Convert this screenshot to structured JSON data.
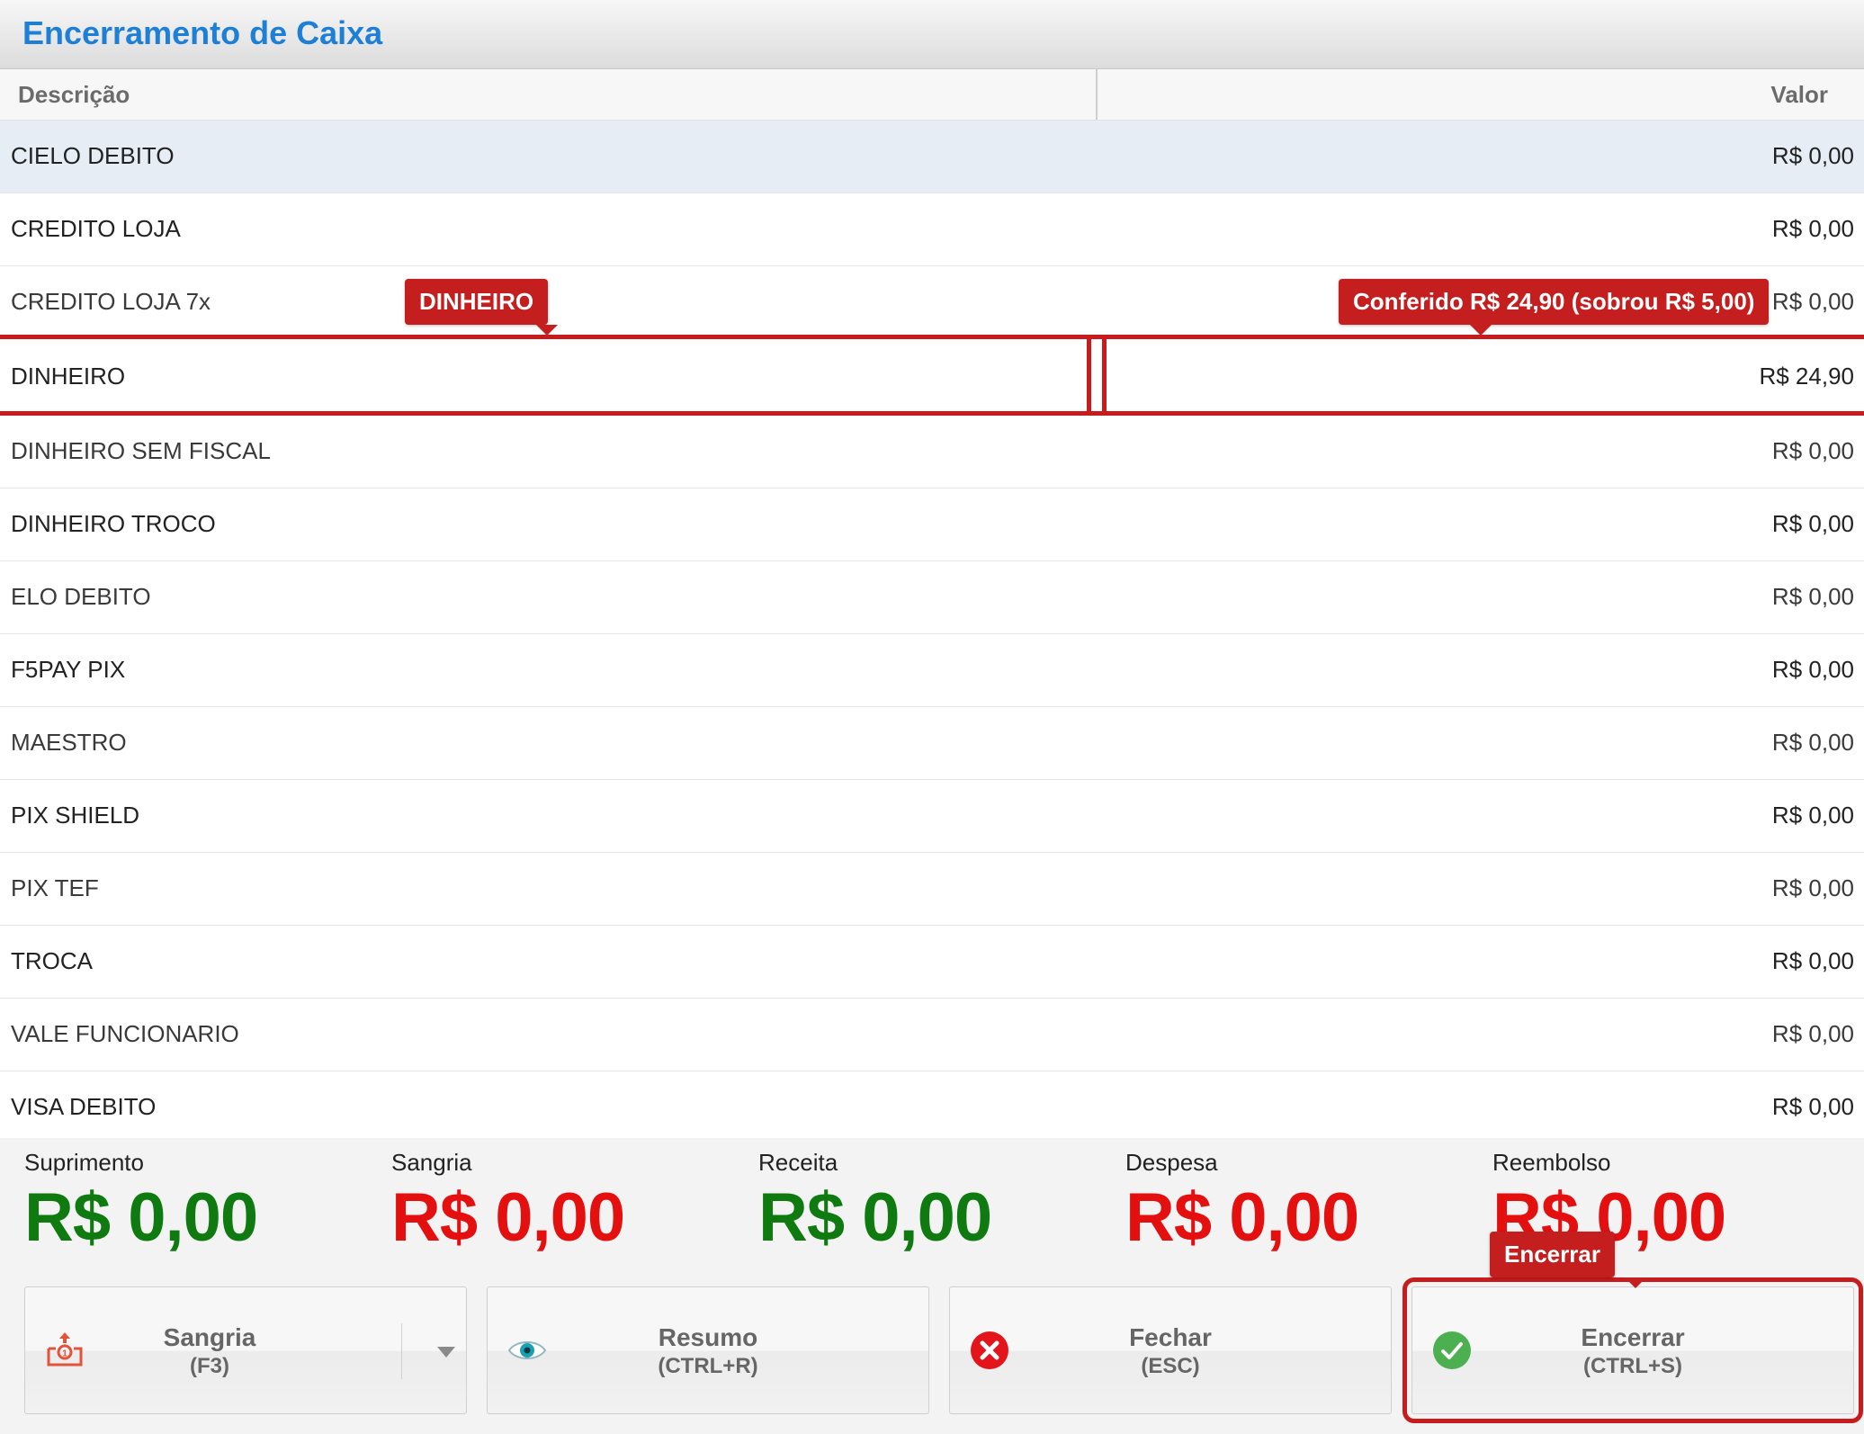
{
  "window": {
    "title": "Encerramento de Caixa"
  },
  "table": {
    "headers": {
      "description": "Descrição",
      "value": "Valor"
    },
    "rows": [
      {
        "label": "CIELO DEBITO",
        "value": "R$ 0,00"
      },
      {
        "label": "CREDITO LOJA",
        "value": "R$ 0,00"
      },
      {
        "label": "CREDITO LOJA 7x",
        "value": "R$ 0,00"
      },
      {
        "label": "DINHEIRO",
        "value": "R$ 24,90"
      },
      {
        "label": "DINHEIRO SEM FISCAL",
        "value": "R$ 0,00"
      },
      {
        "label": "DINHEIRO TROCO",
        "value": "R$ 0,00"
      },
      {
        "label": "ELO DEBITO",
        "value": "R$ 0,00"
      },
      {
        "label": "F5PAY PIX",
        "value": "R$ 0,00"
      },
      {
        "label": "MAESTRO",
        "value": "R$ 0,00"
      },
      {
        "label": "PIX SHIELD",
        "value": "R$ 0,00"
      },
      {
        "label": "PIX TEF",
        "value": "R$ 0,00"
      },
      {
        "label": "TROCA",
        "value": "R$ 0,00"
      },
      {
        "label": "VALE FUNCIONARIO",
        "value": "R$ 0,00"
      },
      {
        "label": "VISA DEBITO",
        "value": "R$ 0,00"
      }
    ],
    "selected_index": 0,
    "editing_index": 3
  },
  "tooltips": {
    "row_desc": "DINHEIRO",
    "row_value": "Conferido R$ 24,90 (sobrou R$ 5,00)",
    "action": "Encerrar"
  },
  "totals": [
    {
      "label": "Suprimento",
      "value": "R$ 0,00",
      "color": "#0f7a0f"
    },
    {
      "label": "Sangria",
      "value": "R$ 0,00",
      "color": "#e40f0f"
    },
    {
      "label": "Receita",
      "value": "R$ 0,00",
      "color": "#0f7a0f"
    },
    {
      "label": "Despesa",
      "value": "R$ 0,00",
      "color": "#e40f0f"
    },
    {
      "label": "Reembolso",
      "value": "R$ 0,00",
      "color": "#e40f0f"
    }
  ],
  "buttons": {
    "sangria": {
      "label": "Sangria",
      "shortcut": "(F3)",
      "icon": "cash-register-icon"
    },
    "resumo": {
      "label": "Resumo",
      "shortcut": "(CTRL+R)",
      "icon": "eye-icon"
    },
    "fechar": {
      "label": "Fechar",
      "shortcut": "(ESC)",
      "icon": "close-circle-icon"
    },
    "encerrar": {
      "label": "Encerrar",
      "shortcut": "(CTRL+S)",
      "icon": "check-circle-icon"
    }
  },
  "colors": {
    "title_blue": "#1e7fd6",
    "error_red": "#c41e1e",
    "ok_green": "#4caf50"
  }
}
